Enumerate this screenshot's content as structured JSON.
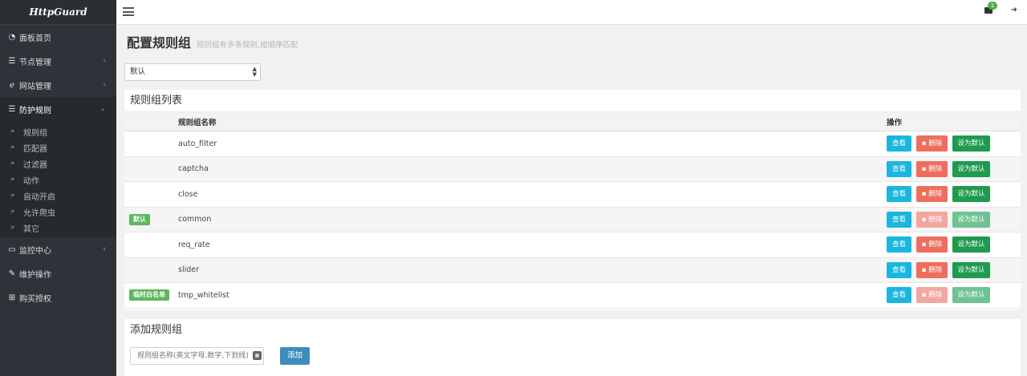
{
  "brand": "HttpGuard",
  "sidebar": {
    "items": [
      {
        "label": "面板首页",
        "icon": "dashboard-icon"
      },
      {
        "label": "节点管理",
        "icon": "list-icon"
      },
      {
        "label": "网站管理",
        "icon": "ie-icon"
      },
      {
        "label": "防护规则",
        "icon": "list-icon"
      },
      {
        "label": "监控中心",
        "icon": "desktop-icon"
      },
      {
        "label": "维护操作",
        "icon": "wrench-icon"
      },
      {
        "label": "购买授权",
        "icon": "cart-icon"
      }
    ],
    "subitems": [
      "规则组",
      "匹配器",
      "过滤器",
      "动作",
      "自动开启",
      "允许爬虫",
      "其它"
    ]
  },
  "topbar": {
    "notification_count": "1"
  },
  "page": {
    "title": "配置规则组",
    "subtitle": "规则组有多条规则,按顺序匹配"
  },
  "select": {
    "value": "默认"
  },
  "rule_groups": {
    "title": "规则组列表",
    "headers": {
      "name": "规则组名称",
      "ops": "操作"
    },
    "buttons": {
      "view": "查看",
      "delete": "删除",
      "set_default": "设为默认"
    },
    "rows": [
      {
        "tag": "",
        "name": "auto_filter"
      },
      {
        "tag": "",
        "name": "captcha"
      },
      {
        "tag": "",
        "name": "close"
      },
      {
        "tag": "默认",
        "name": "common"
      },
      {
        "tag": "",
        "name": "req_rate"
      },
      {
        "tag": "",
        "name": "slider"
      },
      {
        "tag": "临时白名单",
        "name": "tmp_whitelist"
      }
    ]
  },
  "add_group": {
    "title": "添加规则组",
    "placeholder": "规则组名称(英文字母,数字,下划线)",
    "button": "添加"
  },
  "colors": {
    "view": "#1bb6df",
    "delete": "#ee6e5e",
    "set_default": "#1f9a4f",
    "tag": "#5cb85c",
    "add": "#3c8dbc"
  }
}
